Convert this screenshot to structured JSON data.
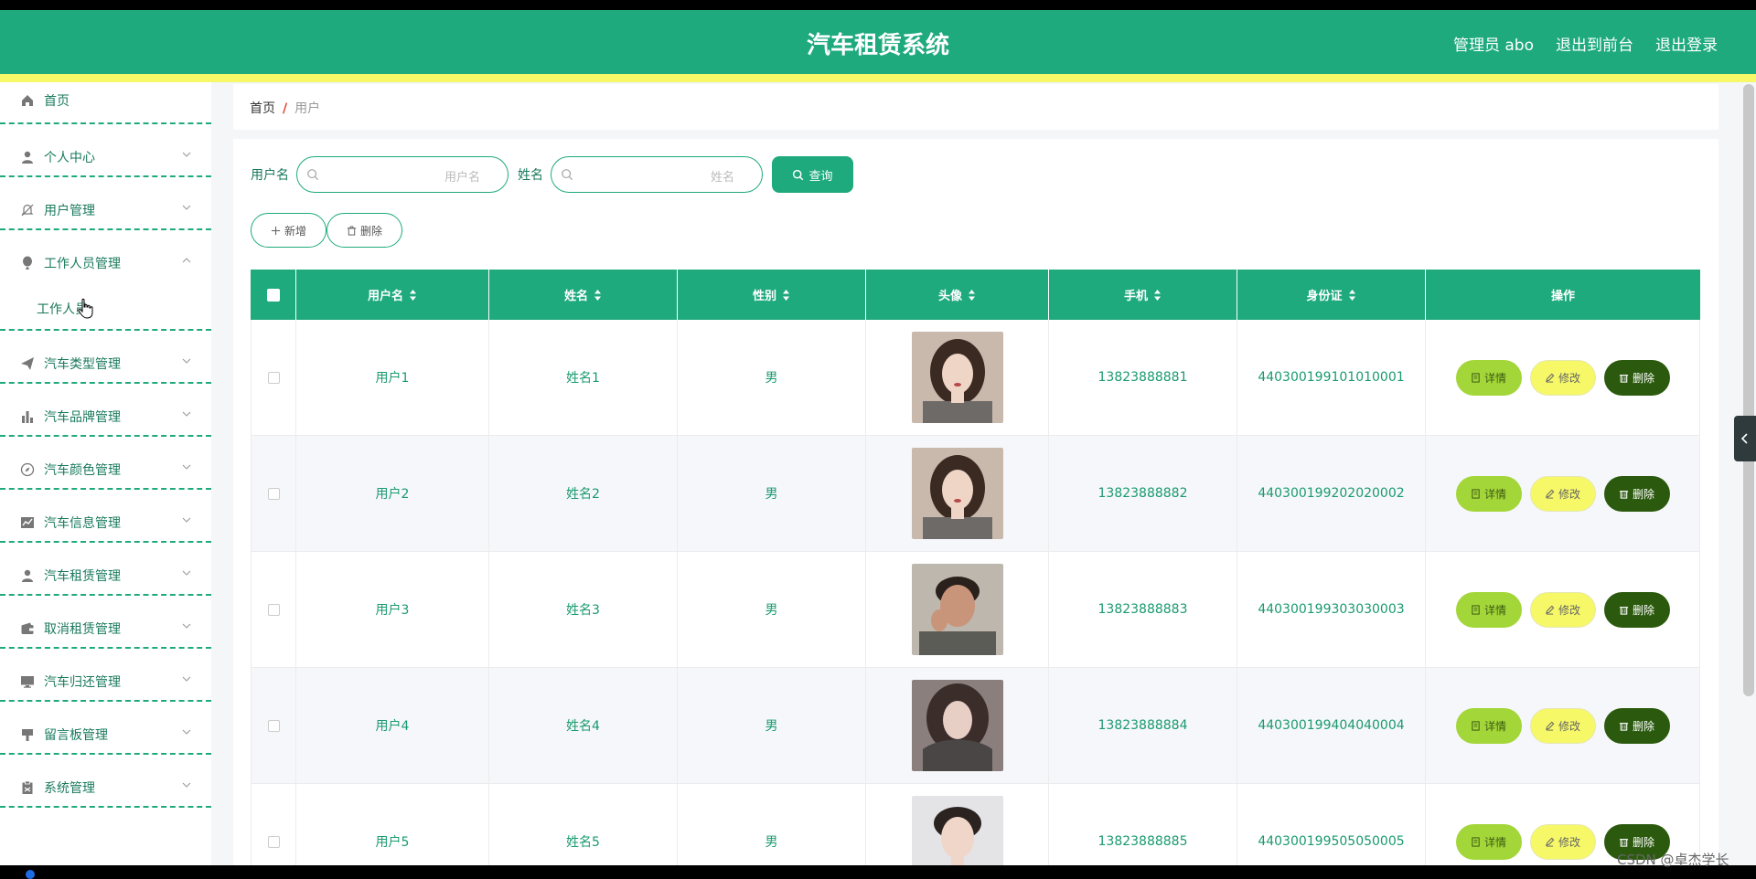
{
  "header": {
    "title": "汽车租赁系统",
    "admin_label": "管理员 abo",
    "front_label": "退出到前台",
    "logout_label": "退出登录"
  },
  "sidebar": {
    "items": [
      {
        "label": "首页",
        "icon": "home-icon"
      },
      {
        "label": "个人中心",
        "icon": "person-icon"
      },
      {
        "label": "用户管理",
        "icon": "bell-off-icon"
      },
      {
        "label": "工作人员管理",
        "icon": "hot-air-balloon-icon",
        "expanded": true,
        "children": [
          "工作人员"
        ]
      },
      {
        "label": "汽车类型管理",
        "icon": "paper-plane-icon"
      },
      {
        "label": "汽车品牌管理",
        "icon": "bar-chart-icon"
      },
      {
        "label": "汽车颜色管理",
        "icon": "compass-icon"
      },
      {
        "label": "汽车信息管理",
        "icon": "line-chart-icon"
      },
      {
        "label": "汽车租赁管理",
        "icon": "person-icon"
      },
      {
        "label": "取消租赁管理",
        "icon": "wallet-icon"
      },
      {
        "label": "汽车归还管理",
        "icon": "monitor-icon"
      },
      {
        "label": "留言板管理",
        "icon": "brush-icon"
      },
      {
        "label": "系统管理",
        "icon": "clipboard-icon"
      }
    ]
  },
  "breadcrumb": {
    "home": "首页",
    "sep": "/",
    "current": "用户"
  },
  "search": {
    "username_label": "用户名",
    "username_placeholder": "用户名",
    "name_label": "姓名",
    "name_placeholder": "姓名",
    "query_label": "查询"
  },
  "actions": {
    "add_label": "新增",
    "delete_label": "删除"
  },
  "table": {
    "columns": [
      "用户名",
      "姓名",
      "性别",
      "头像",
      "手机",
      "身份证",
      "操作"
    ],
    "rows": [
      {
        "username": "用户1",
        "name": "姓名1",
        "gender": "男",
        "avatar": "female-portrait-1",
        "phone": "13823888881",
        "id_card": "440300199101010001"
      },
      {
        "username": "用户2",
        "name": "姓名2",
        "gender": "男",
        "avatar": "female-portrait-1",
        "phone": "13823888882",
        "id_card": "440300199202020002"
      },
      {
        "username": "用户3",
        "name": "姓名3",
        "gender": "男",
        "avatar": "male-portrait-1",
        "phone": "13823888883",
        "id_card": "440300199303030003"
      },
      {
        "username": "用户4",
        "name": "姓名4",
        "gender": "男",
        "avatar": "female-portrait-2",
        "phone": "13823888884",
        "id_card": "440300199404040004"
      },
      {
        "username": "用户5",
        "name": "姓名5",
        "gender": "男",
        "avatar": "male-portrait-2",
        "phone": "13823888885",
        "id_card": "440300199505050005"
      }
    ],
    "op_labels": {
      "detail": "详情",
      "edit": "修改",
      "delete": "删除"
    }
  },
  "watermark": "CSDN @卓杰学长",
  "colors": {
    "primary": "#1eaa7c",
    "accent_yellow": "#f6f868",
    "detail_green": "#a3d638",
    "delete_dark": "#2b5a0e"
  }
}
